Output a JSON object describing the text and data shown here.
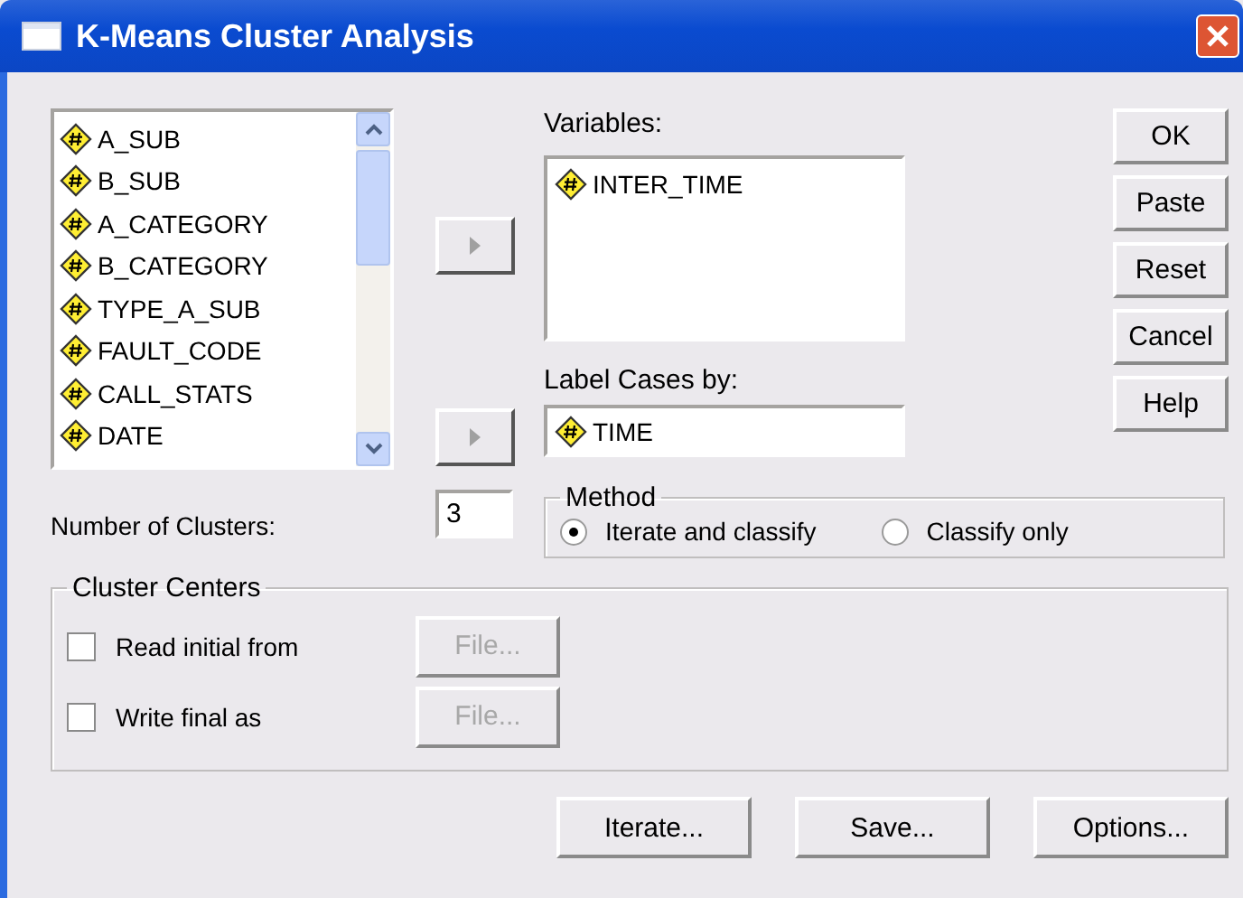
{
  "window": {
    "title": "K-Means Cluster Analysis"
  },
  "source_list": {
    "items": [
      {
        "label": "A_SUB"
      },
      {
        "label": "B_SUB"
      },
      {
        "label": "A_CATEGORY"
      },
      {
        "label": "B_CATEGORY"
      },
      {
        "label": "TYPE_A_SUB"
      },
      {
        "label": "FAULT_CODE"
      },
      {
        "label": "CALL_STATS"
      },
      {
        "label": "DATE"
      }
    ]
  },
  "variables": {
    "label": "Variables:",
    "items": [
      {
        "label": "INTER_TIME"
      }
    ]
  },
  "label_cases": {
    "label": "Label Cases by:",
    "value": "TIME"
  },
  "side_buttons": [
    {
      "label": "OK"
    },
    {
      "label": "Paste"
    },
    {
      "label": "Reset"
    },
    {
      "label": "Cancel"
    },
    {
      "label": "Help"
    }
  ],
  "number_of_clusters": {
    "label": "Number of Clusters:",
    "value": "3"
  },
  "method": {
    "title": "Method",
    "options": [
      {
        "label": "Iterate and classify",
        "selected": true
      },
      {
        "label": "Classify only",
        "selected": false
      }
    ]
  },
  "cluster_centers": {
    "title": "Cluster Centers",
    "rows": [
      {
        "label": "Read initial from",
        "checked": false,
        "button": "File...",
        "disabled": true
      },
      {
        "label": "Write final as",
        "checked": false,
        "button": "File...",
        "disabled": true
      }
    ]
  },
  "bottom_buttons": [
    {
      "label": "Iterate..."
    },
    {
      "label": "Save..."
    },
    {
      "label": "Options..."
    }
  ]
}
